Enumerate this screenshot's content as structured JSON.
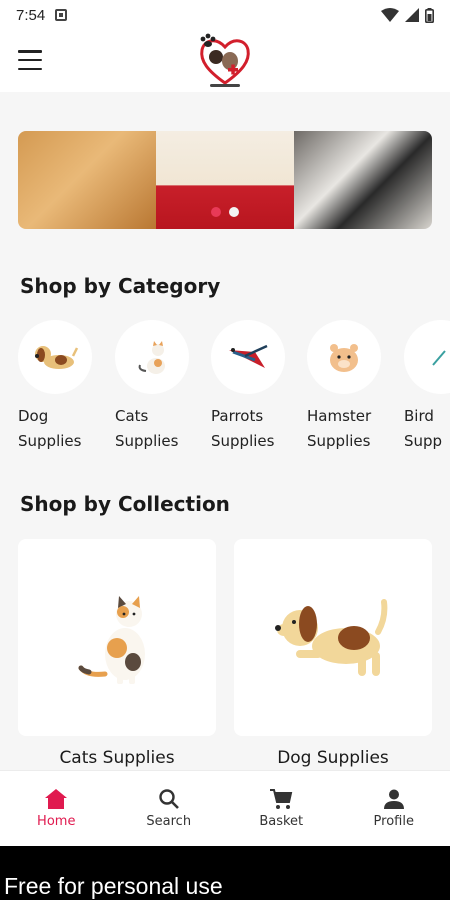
{
  "status_bar": {
    "time": "7:54"
  },
  "app_bar": {
    "menu_icon": "hamburger-menu-icon",
    "logo_icon": "pet-clinic-logo"
  },
  "banner": {
    "slides": [
      "pomeranian-dog-photo",
      "white-persian-cat-photo",
      "puppies-in-basket-photo"
    ],
    "active_index": 1
  },
  "shop_by_category": {
    "title": "Shop by Category",
    "items": [
      {
        "label": "Dog\nSupplies",
        "icon": "dog-icon"
      },
      {
        "label": "Cats\nSupplies",
        "icon": "cat-icon"
      },
      {
        "label": "Parrots\nSupplies",
        "icon": "parrot-icon"
      },
      {
        "label": "Hamster\nSupplies",
        "icon": "hamster-icon"
      },
      {
        "label": "Bird\nSupp",
        "icon": "bird-icon"
      }
    ]
  },
  "shop_by_collection": {
    "title": "Shop by Collection",
    "items": [
      {
        "label": "Cats Supplies",
        "icon": "calico-cat-illustration"
      },
      {
        "label": "Dog Supplies",
        "icon": "beagle-dog-illustration"
      }
    ]
  },
  "bottom_nav": {
    "items": [
      {
        "label": "Home",
        "icon": "home-icon",
        "active": true
      },
      {
        "label": "Search",
        "icon": "search-icon",
        "active": false
      },
      {
        "label": "Basket",
        "icon": "cart-icon",
        "active": false
      },
      {
        "label": "Profile",
        "icon": "profile-icon",
        "active": false
      }
    ]
  },
  "watermark": {
    "text": "Free for personal use"
  },
  "colors": {
    "accent": "#e01a4f",
    "background": "#f6f6f6",
    "card": "#ffffff"
  }
}
